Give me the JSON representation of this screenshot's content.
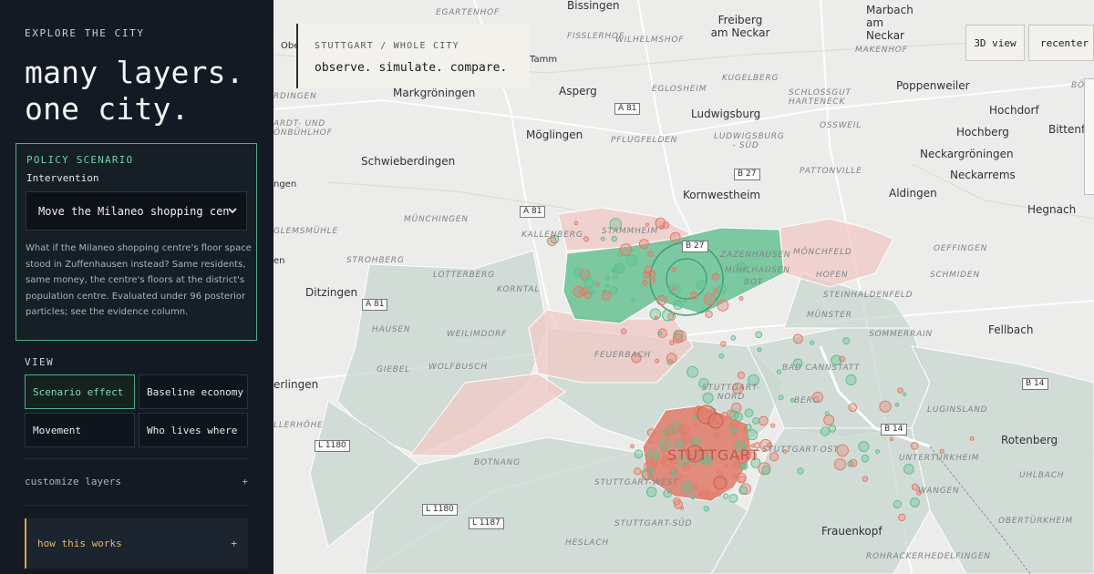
{
  "sidebar": {
    "eyebrow": "EXPLORE THE CITY",
    "headline_line1": "many layers.",
    "headline_line2": "one city.",
    "policy": {
      "heading": "POLICY SCENARIO",
      "intervention_label": "Intervention",
      "selected": "Move the Milaneo shopping cen",
      "description": "What if the Milaneo shopping centre's floor space stood in Zuffenhausen instead? Same residents, same money, the centre's floors at the district's population centre. Evaluated under 96 posterior particles; see the evidence column."
    },
    "view": {
      "label": "VIEW",
      "buttons": [
        "Scenario effect",
        "Baseline economy",
        "Movement",
        "Who lives where"
      ],
      "active": "Scenario effect"
    },
    "customize_label": "customize layers",
    "customize_toggle": "+",
    "how_label": "how this works",
    "how_toggle": "+"
  },
  "map": {
    "context_line1": "STUTTGART / WHOLE CITY",
    "context_line2": "observe. simulate. compare.",
    "btn_3d": "3D view",
    "btn_recenter": "recenter ↙",
    "colors": {
      "gain": "#5fbf8f",
      "loss": "#e27b6b",
      "neutral": "#c9d7d0"
    },
    "towns": [
      "Bissingen",
      "Freiberg am Neckar",
      "Marbach am Neckar",
      "Asperg",
      "Ludwigsburg",
      "Markgröningen",
      "Möglingen",
      "Schwieberdingen",
      "Kornwestheim",
      "Aldingen",
      "Poppenweiler",
      "Hochdorf",
      "Hochberg",
      "Neckargröningen",
      "Neckarrems",
      "Bittenfel",
      "Hegnach",
      "Ditzingen",
      "Fellbach",
      "Rotenberg",
      "Frauenkopf",
      "erlingen",
      "Obe",
      "Tamm",
      "ngen",
      "en"
    ],
    "districts": [
      "EGARTENHOF",
      "FISSLERHOF",
      "WILHELMSHOF",
      "EGLOSHEIM",
      "KUGELBERG",
      "MAKENHOF",
      "SCHLOSSGUT HARTENECK",
      "OSSWEIL",
      "PFLUGFELDEN",
      "LUDWIGSBURG - SÜD",
      "PATTONVILLE",
      "KALLENBERG",
      "STAMMHEIM",
      "ZAZENHAUSEN",
      "MÜHLHAUSEN",
      "MÖNCHFELD",
      "HOFEN",
      "MÜNCHINGEN",
      "STROHBERG",
      "LOTTERBERG",
      "KORNTAL",
      "STEINHALDENFELD",
      "OEFFINGEN",
      "SCHMIDEN",
      "WEILIMDORF",
      "FEUERBACH",
      "MÜNSTER",
      "SOMMERRAIN",
      "GIEBEL",
      "WOLFBUSCH",
      "BAD CANNSTATT",
      "STUTTGART-NORD",
      "BERG",
      "LUGINSLAND",
      "STUTTGART",
      "STUTTGART-OST",
      "BOTNANG",
      "STUTTGART-WEST",
      "UNTERTÜRKHEIM",
      "UHLBACH",
      "WANGEN",
      "STUTTGART-SÜD",
      "OBERTÜRKHEIM",
      "HESLACH",
      "ROHRACKER",
      "HEDELFINGEN",
      "HAUSEN",
      "GLEMSMÜHLE",
      "LLERHÖHE",
      "RDINGEN",
      "BÖL",
      "BOT",
      "ARDT- UND ÖNBÜHLHOF",
      "BERG"
    ],
    "roads": [
      "A 81",
      "A 81",
      "A 81",
      "B 27",
      "B 27",
      "B 14",
      "B 14",
      "L 1180",
      "L 1180",
      "L 1187",
      "B 27"
    ]
  }
}
